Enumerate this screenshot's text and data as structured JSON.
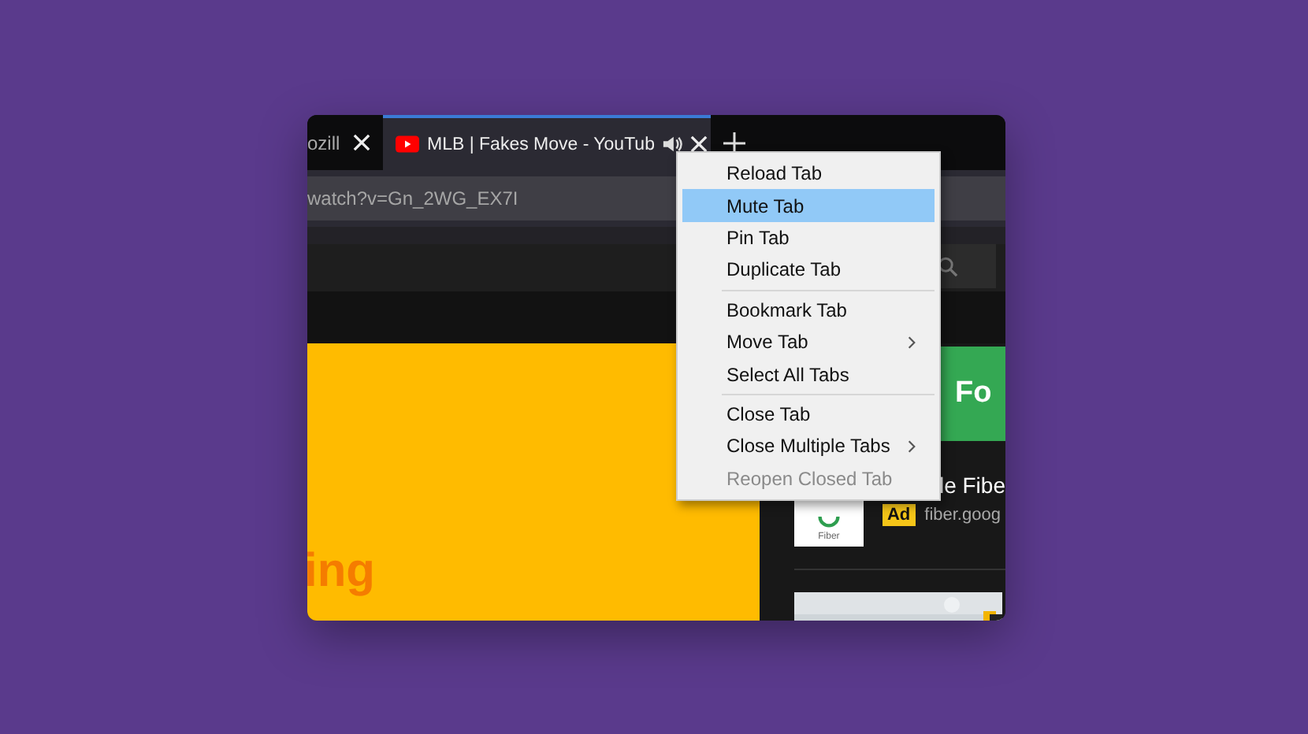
{
  "browser": {
    "tabs": [
      {
        "title": "ozill",
        "selected": false,
        "audio": false
      },
      {
        "title": "MLB | Fakes Move - YouTub",
        "selected": true,
        "audio": true
      }
    ],
    "address": "watch?v=Gn_2WG_EX7I",
    "page": {
      "banner_text": "ing",
      "card_heading": "Fo",
      "ad_title": "le Fibe",
      "logo_label": "Fiber",
      "badge": "Ad",
      "ad_url": "fiber.goog"
    }
  },
  "context_menu": {
    "items": [
      {
        "kind": "item",
        "label": "Reload Tab",
        "selected": false,
        "disabled": false,
        "submenu": false
      },
      {
        "kind": "item",
        "label": "Mute Tab",
        "selected": true,
        "disabled": false,
        "submenu": false
      },
      {
        "kind": "item",
        "label": "Pin Tab",
        "selected": false,
        "disabled": false,
        "submenu": false
      },
      {
        "kind": "item",
        "label": "Duplicate Tab",
        "selected": false,
        "disabled": false,
        "submenu": false
      },
      {
        "kind": "separator"
      },
      {
        "kind": "item",
        "label": "Bookmark Tab",
        "selected": false,
        "disabled": false,
        "submenu": false
      },
      {
        "kind": "item",
        "label": "Move Tab",
        "selected": false,
        "disabled": false,
        "submenu": true
      },
      {
        "kind": "item",
        "label": "Select All Tabs",
        "selected": false,
        "disabled": false,
        "submenu": false
      },
      {
        "kind": "separator"
      },
      {
        "kind": "item",
        "label": "Close Tab",
        "selected": false,
        "disabled": false,
        "submenu": false
      },
      {
        "kind": "item",
        "label": "Close Multiple Tabs",
        "selected": false,
        "disabled": false,
        "submenu": true
      },
      {
        "kind": "item",
        "label": "Reopen Closed Tab",
        "selected": false,
        "disabled": true,
        "submenu": false
      }
    ]
  }
}
